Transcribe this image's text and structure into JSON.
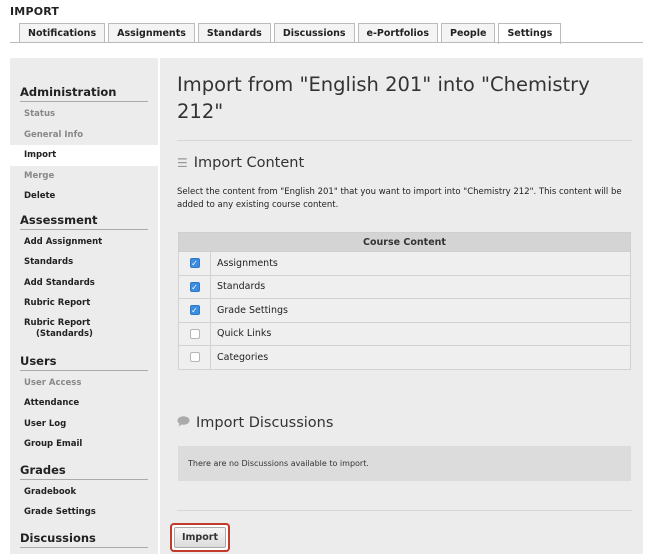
{
  "header": {
    "title": "IMPORT"
  },
  "tabs": [
    {
      "label": "Notifications"
    },
    {
      "label": "Assignments"
    },
    {
      "label": "Standards"
    },
    {
      "label": "Discussions"
    },
    {
      "label": "e-Portfolios"
    },
    {
      "label": "People"
    },
    {
      "label": "Settings"
    }
  ],
  "sidebar": {
    "administration": {
      "heading": "Administration",
      "items": [
        "Status",
        "General Info",
        "Import",
        "Merge",
        "Delete"
      ]
    },
    "assessment": {
      "heading": "Assessment",
      "items": [
        "Add Assignment",
        "Standards",
        "Add Standards",
        "Rubric Report",
        "Rubric Report",
        "(Standards)"
      ]
    },
    "users": {
      "heading": "Users",
      "items": [
        "User Access",
        "Attendance",
        "User Log",
        "Group Email"
      ]
    },
    "grades": {
      "heading": "Grades",
      "items": [
        "Gradebook",
        "Grade Settings"
      ]
    },
    "discussions": {
      "heading": "Discussions"
    }
  },
  "main": {
    "title": "Import from \"English 201\" into \"Chemistry 212\"",
    "import_content": {
      "heading": "Import Content",
      "description": "Select the content from \"English 201\" that you want to import into \"Chemistry 212\". This content will be added to any existing course content.",
      "table_header": "Course Content",
      "rows": [
        {
          "label": "Assignments",
          "checked": true
        },
        {
          "label": "Standards",
          "checked": true
        },
        {
          "label": "Grade Settings",
          "checked": true
        },
        {
          "label": "Quick Links",
          "checked": false
        },
        {
          "label": "Categories",
          "checked": false
        }
      ]
    },
    "import_discussions": {
      "heading": "Import Discussions",
      "empty_message": "There are no Discussions available to import."
    },
    "import_button": "Import"
  },
  "colors": {
    "accent_checkbox": "#3b8de0",
    "highlight_outline": "#c23a2b"
  }
}
